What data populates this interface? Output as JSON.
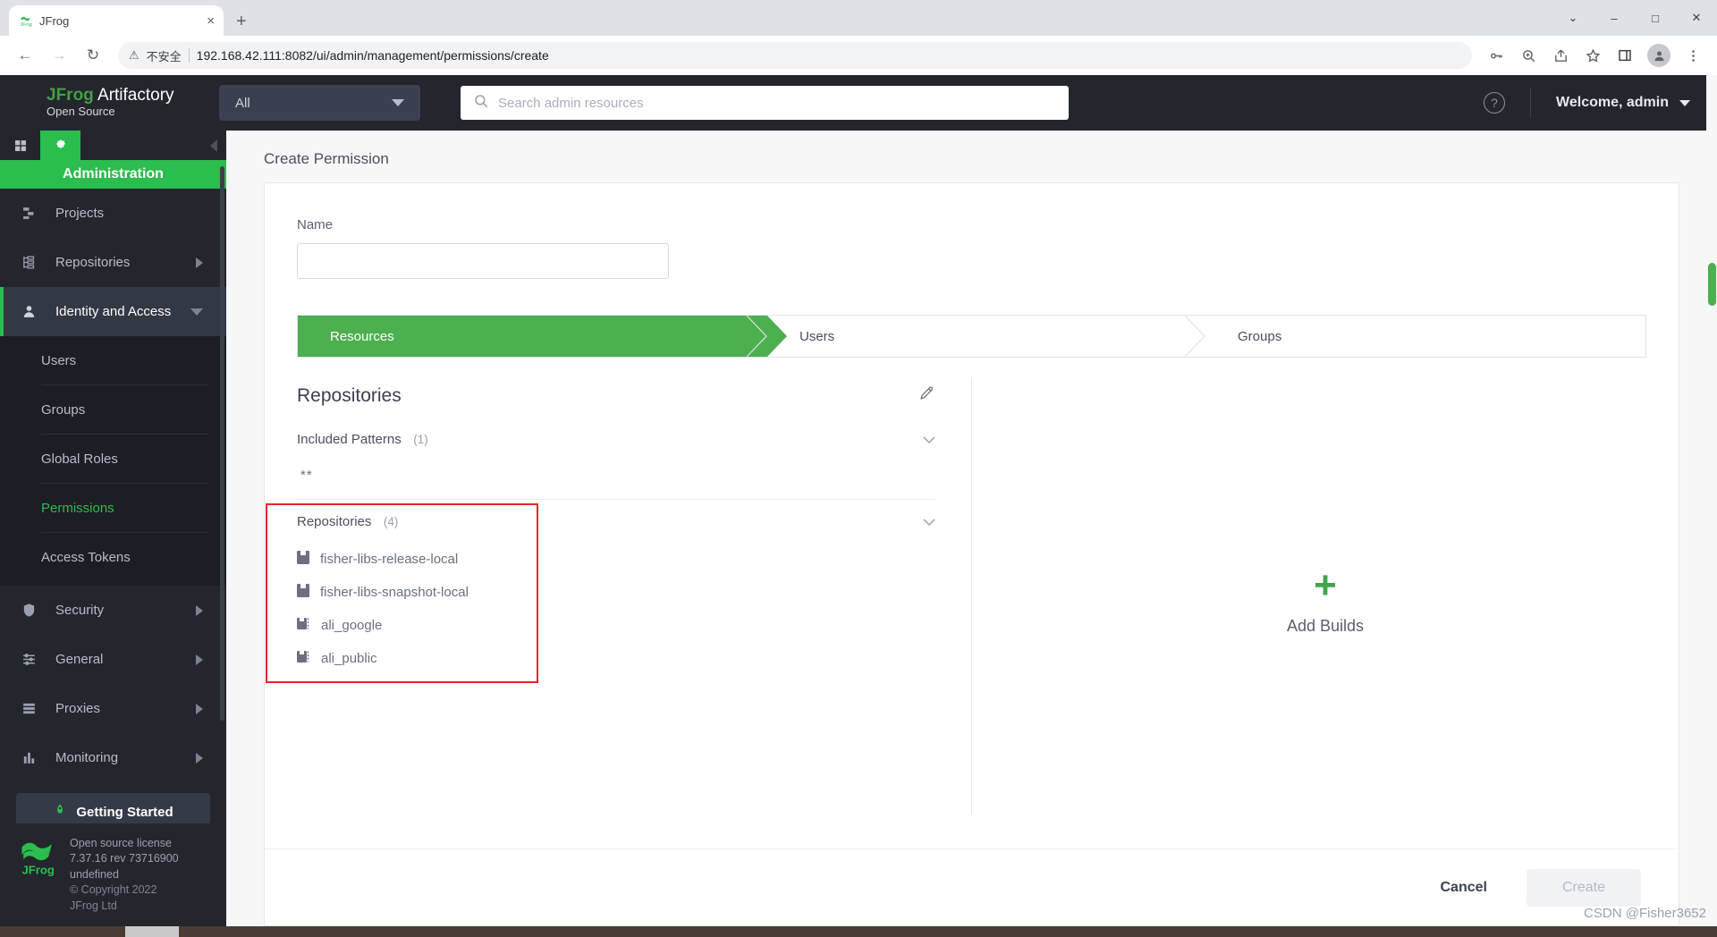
{
  "browser": {
    "tab_title": "JFrog",
    "tab_favicon": "jfrog-favicon",
    "close_label": "×",
    "newtab_label": "+",
    "back_label": "←",
    "forward_label": "→",
    "reload_label": "↻",
    "security_warning": "不安全",
    "warning_icon": "⚠",
    "url": "192.168.42.111:8082/ui/admin/management/permissions/create",
    "window_minimize": "–",
    "window_maximize": "□",
    "window_close": "✕",
    "window_chevron": "⌄",
    "toolbar_icons": [
      "key-icon",
      "zoom-icon",
      "share-icon",
      "star-icon",
      "side-panel-icon",
      "profile-icon",
      "more-menu-icon"
    ]
  },
  "header": {
    "brand_jfrog": "JFrog",
    "brand_product": "Artifactory",
    "brand_edition": "Open Source",
    "scope_selected": "All",
    "search_placeholder": "Search admin resources",
    "search_value": "",
    "help_label": "?",
    "welcome": "Welcome, admin"
  },
  "sidebar": {
    "banner": "Administration",
    "items": [
      {
        "label": "Projects",
        "icon": "projects-icon",
        "has_arrow": false,
        "active": false
      },
      {
        "label": "Repositories",
        "icon": "repositories-icon",
        "has_arrow": true,
        "active": false
      },
      {
        "label": "Identity and Access",
        "icon": "user-icon",
        "has_arrow": true,
        "active": true
      }
    ],
    "subitems": [
      {
        "label": "Users",
        "current": false
      },
      {
        "label": "Groups",
        "current": false
      },
      {
        "label": "Global Roles",
        "current": false
      },
      {
        "label": "Permissions",
        "current": true
      },
      {
        "label": "Access Tokens",
        "current": false
      }
    ],
    "items_lower": [
      {
        "label": "Security",
        "icon": "shield-icon",
        "has_arrow": true
      },
      {
        "label": "General",
        "icon": "sliders-icon",
        "has_arrow": true
      },
      {
        "label": "Proxies",
        "icon": "server-icon",
        "has_arrow": true
      },
      {
        "label": "Monitoring",
        "icon": "chart-icon",
        "has_arrow": true
      }
    ],
    "getting_started": "Getting Started",
    "license": {
      "line1": "Open source license",
      "line2": "7.37.16 rev 73716900",
      "line3": "undefined",
      "line4": "© Copyright 2022",
      "line5": "JFrog Ltd"
    }
  },
  "main": {
    "page_title": "Create Permission",
    "name_label": "Name",
    "name_value": "",
    "name_placeholder": "",
    "wizard": [
      {
        "label": "Resources",
        "active": true
      },
      {
        "label": "Users",
        "active": false
      },
      {
        "label": "Groups",
        "active": false
      }
    ],
    "repositories_panel": {
      "title": "Repositories",
      "edit_icon": "pencil-icon",
      "included_patterns_label": "Included Patterns",
      "included_patterns_count": "(1)",
      "patterns": [
        "**"
      ],
      "repositories_label": "Repositories",
      "repositories_count": "(4)",
      "repositories": [
        {
          "name": "fisher-libs-release-local",
          "icon": "local-repo-icon"
        },
        {
          "name": "fisher-libs-snapshot-local",
          "icon": "local-repo-icon"
        },
        {
          "name": "ali_google",
          "icon": "remote-repo-icon"
        },
        {
          "name": "ali_public",
          "icon": "remote-repo-icon"
        }
      ]
    },
    "builds_panel": {
      "plus": "+",
      "label": "Add Builds"
    },
    "footer": {
      "cancel_label": "Cancel",
      "create_label": "Create"
    }
  },
  "watermark": "CSDN @Fisher3652",
  "colors": {
    "green": "#2bbd4e",
    "wizard_green": "#4caf50",
    "dark_nav": "#23262d",
    "red_highlight": "#e8222a"
  }
}
